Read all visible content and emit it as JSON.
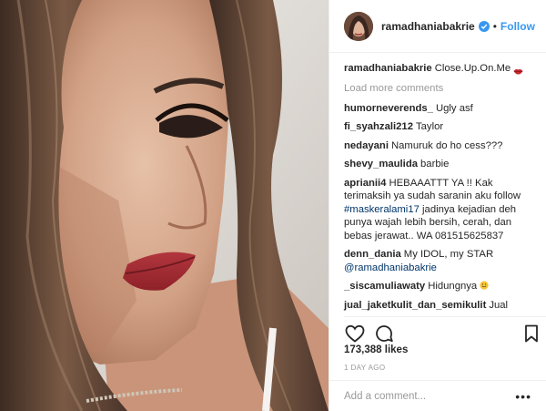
{
  "post": {
    "photo": {
      "subject": "close-up portrait photo"
    },
    "header": {
      "username": "ramadhaniabakrie",
      "separator": "•",
      "follow_label": "Follow",
      "verified_icon": "verified-badge-icon"
    },
    "caption": {
      "username": "ramadhaniabakrie",
      "text": "Close.Up.On.Me",
      "emoji": "kiss-lips-emoji"
    },
    "load_more_label": "Load more comments",
    "comments": [
      {
        "user": "humorneverends_",
        "text": "Ugly asf"
      },
      {
        "user": "fi_syahzali212",
        "text": "Taylor"
      },
      {
        "user": "nedayani",
        "text": "Namuruk do ho cess???"
      },
      {
        "user": "shevy_maulida",
        "text": "barbie"
      },
      {
        "user": "aprianii4",
        "text": "HEBAAATTT YA !! Kak terimaksih ya sudah saranin aku follow",
        "hashtag": "#maskeralami17",
        "text_after": "jadinya kejadian deh punya wajah lebih bersih, cerah, dan bebas jerawat.. WA 081515625837"
      },
      {
        "user": "denn_dania",
        "text": "My IDOL, my STAR",
        "mention": "@ramadhaniabakrie"
      },
      {
        "user": "_siscamuliawaty",
        "text": "Hidungnya",
        "emoji": "grinning-face-emoji"
      },
      {
        "user": "jual_jaketkulit_dan_semikulit",
        "text": "Jual jaket kulit dan semikulit berkualias import premium mulai dari anak sampai dewasa"
      }
    ],
    "actions": {
      "like_icon": "heart-icon",
      "comment_icon": "comment-bubble-icon",
      "save_icon": "bookmark-icon"
    },
    "likes_label": "173,388 likes",
    "timestamp": "1 DAY AGO",
    "add_comment": {
      "placeholder": "Add a comment...",
      "options": "•••"
    },
    "colors": {
      "link_blue": "#3897f0",
      "hashtag_navy": "#003569",
      "muted_gray": "#999999",
      "text": "#262626",
      "border": "#efefef"
    }
  }
}
